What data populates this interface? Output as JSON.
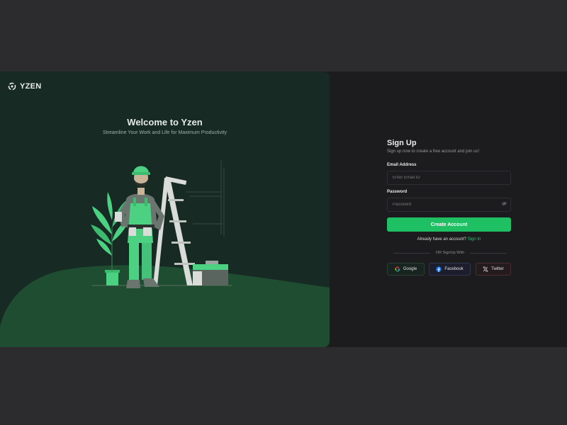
{
  "brand": {
    "name": "YZEN"
  },
  "hero": {
    "title": "Welcome to Yzen",
    "subtitle": "Streamline Your Work and Life for Maximum Productivity"
  },
  "form": {
    "title": "Sign Up",
    "subtitle": "Sign up now to create a free account and join us!",
    "email": {
      "label": "Email Address",
      "placeholder": "Enter Email ID",
      "value": ""
    },
    "password": {
      "label": "Password",
      "placeholder": "Password",
      "value": ""
    },
    "submit_label": "Create Account",
    "have_account_text": "Already have an account?",
    "signin_link": "Sign In",
    "divider_text": "OR SignUp With",
    "socials": {
      "google": "Google",
      "facebook": "Facebook",
      "twitter": "Twitter"
    }
  },
  "colors": {
    "accent": "#1fbf64",
    "left_panel": "#172a24",
    "hill": "#1e4d32",
    "right_panel": "#1c1c1e",
    "page_bg": "#2c2c2e"
  },
  "icons": [
    "brand-logo-icon",
    "eye-off-icon",
    "google-icon",
    "facebook-icon",
    "x-twitter-icon"
  ]
}
